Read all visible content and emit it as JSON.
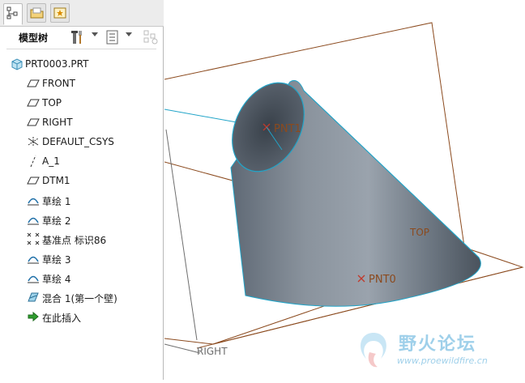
{
  "panel": {
    "tabs": [
      {
        "name": "model-tree-tab",
        "active": true
      },
      {
        "name": "folder-browser-tab",
        "active": false
      },
      {
        "name": "favorites-tab",
        "active": false
      }
    ],
    "title": "模型树",
    "tree": {
      "root": "PRT0003.PRT",
      "items": [
        {
          "label": "FRONT",
          "icon": "datum-plane-icon"
        },
        {
          "label": "TOP",
          "icon": "datum-plane-icon"
        },
        {
          "label": "RIGHT",
          "icon": "datum-plane-icon"
        },
        {
          "label": "DEFAULT_CSYS",
          "icon": "csys-icon"
        },
        {
          "label": "A_1",
          "icon": "datum-axis-icon"
        },
        {
          "label": "DTM1",
          "icon": "datum-plane-icon"
        },
        {
          "label": "草绘 1",
          "icon": "sketch-icon"
        },
        {
          "label": "草绘 2",
          "icon": "sketch-icon"
        },
        {
          "label": "基准点 标识86",
          "icon": "datum-point-icon"
        },
        {
          "label": "草绘 3",
          "icon": "sketch-icon"
        },
        {
          "label": "草绘 4",
          "icon": "sketch-icon"
        },
        {
          "label": "混合 1(第一个壁)",
          "icon": "blend-feature-icon"
        },
        {
          "label": "在此插入",
          "icon": "insert-here-arrow-icon"
        }
      ]
    }
  },
  "viewport": {
    "labels": {
      "pnt1": "PNT1",
      "pnt0": "PNT0",
      "top": "TOP",
      "right": "RIGHT"
    },
    "colors": {
      "datum_plane": "#8b4a1e",
      "edge": "#21a4c8",
      "point": "#c0392b"
    }
  },
  "watermark": {
    "title": "野火论坛",
    "url": "www.proewildfire.cn"
  }
}
